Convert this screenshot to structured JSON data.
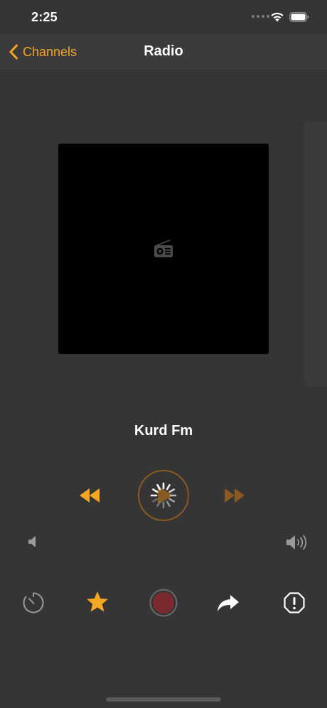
{
  "status_bar": {
    "time": "2:25"
  },
  "nav": {
    "back_label": "Channels",
    "title": "Radio"
  },
  "player": {
    "station_name": "Kurd Fm",
    "state": "loading"
  },
  "icons": {
    "back": "chevron-left-icon",
    "artwork_placeholder": "radio-icon",
    "rewind": "rewind-icon",
    "play": "play-icon",
    "forward": "fast-forward-icon",
    "volume_low": "volume-low-icon",
    "volume_high": "volume-high-icon",
    "timer": "timer-icon",
    "favorite": "star-icon",
    "record": "record-icon",
    "share": "share-icon",
    "report": "report-icon"
  },
  "colors": {
    "accent": "#f5a623",
    "background": "#353535",
    "nav_background": "#3b3b3b",
    "record": "#7a2a2e"
  }
}
